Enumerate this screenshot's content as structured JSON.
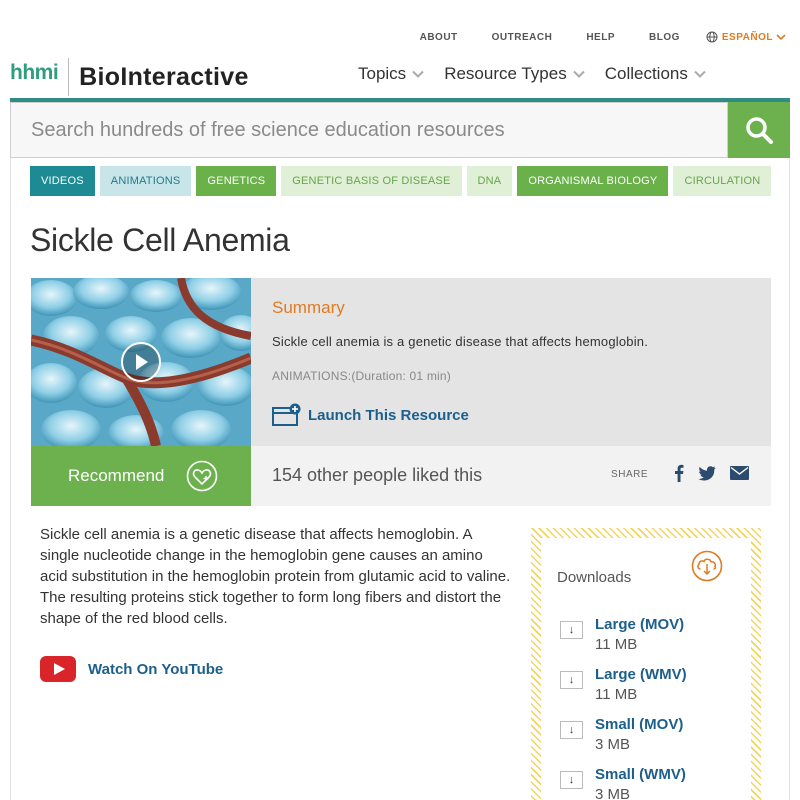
{
  "util_nav": {
    "about": "ABOUT",
    "outreach": "OUTREACH",
    "help": "HELP",
    "blog": "BLOG",
    "espanol": "ESPAÑOL"
  },
  "brand": {
    "hhmi": "hhmi",
    "name": "BioInteractive"
  },
  "main_nav": {
    "topics": "Topics",
    "resource_types": "Resource Types",
    "collections": "Collections"
  },
  "search": {
    "placeholder": "Search hundreds of free science education resources"
  },
  "tags": [
    "VIDEOS",
    "ANIMATIONS",
    "GENETICS",
    "GENETIC BASIS OF DISEASE",
    "DNA",
    "ORGANISMAL BIOLOGY",
    "CIRCULATION"
  ],
  "page_title": "Sickle Cell Anemia",
  "summary": {
    "heading": "Summary",
    "text": "Sickle cell anemia is a genetic disease that affects hemoglobin.",
    "meta": "ANIMATIONS:(Duration: 01 min)",
    "launch_label": "Launch This Resource"
  },
  "recommend": {
    "label": "Recommend",
    "liked_text": "154 other people liked this",
    "share_label": "SHARE"
  },
  "description": "Sickle cell anemia is a genetic disease that affects hemoglobin. A single nucleotide change in the hemoglobin gene causes an amino acid substitution in the hemoglobin protein from glutamic acid to valine. The resulting proteins stick together to form long fibers and distort the shape of the red blood cells.",
  "youtube_label": "Watch On YouTube",
  "downloads": {
    "heading": "Downloads",
    "items": [
      {
        "name": "Large (MOV)",
        "size": "11 MB"
      },
      {
        "name": "Large (WMV)",
        "size": "11 MB"
      },
      {
        "name": "Small (MOV)",
        "size": "3 MB"
      },
      {
        "name": "Small (WMV)",
        "size": "3 MB"
      }
    ]
  },
  "colors": {
    "accent_green": "#6db14e",
    "teal": "#2f8c84",
    "orange": "#e07b22",
    "link_blue": "#1d5f8c"
  }
}
